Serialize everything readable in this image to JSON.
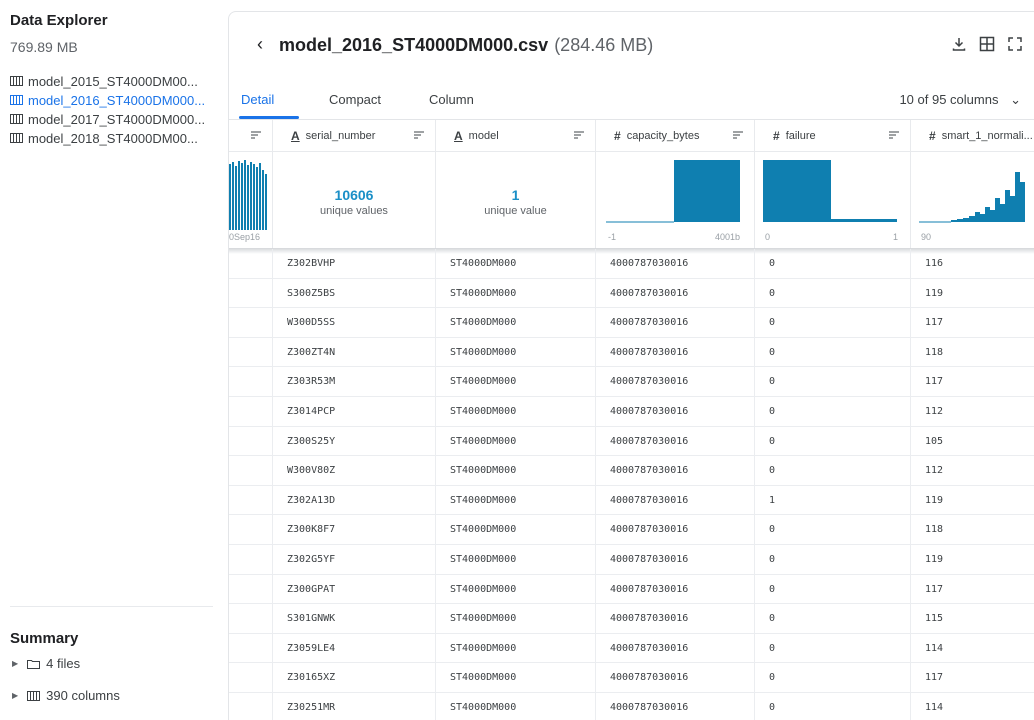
{
  "sidebar": {
    "title": "Data Explorer",
    "size": "769.89 MB",
    "files": [
      {
        "label": "model_2015_ST4000DM00...",
        "active": false
      },
      {
        "label": "model_2016_ST4000DM000...",
        "active": true
      },
      {
        "label": "model_2017_ST4000DM000...",
        "active": false
      },
      {
        "label": "model_2018_ST4000DM00...",
        "active": false
      }
    ],
    "summary_title": "Summary",
    "summary_files": "4 files",
    "summary_columns": "390 columns"
  },
  "header": {
    "back_icon": "chevron-left-icon",
    "file_name": "model_2016_ST4000DM000.csv",
    "file_size": "(284.46 MB)",
    "actions": [
      "download-icon",
      "table-view-icon",
      "fullscreen-icon"
    ]
  },
  "tabs": [
    {
      "label": "Detail",
      "active": true
    },
    {
      "label": "Compact",
      "active": false
    },
    {
      "label": "Column",
      "active": false
    }
  ],
  "columns_count": "10 of 95 columns",
  "grid": {
    "columns": [
      {
        "type": "",
        "name": ""
      },
      {
        "type": "A",
        "name": "serial_number"
      },
      {
        "type": "A",
        "name": "model"
      },
      {
        "type": "#",
        "name": "capacity_bytes"
      },
      {
        "type": "#",
        "name": "failure"
      },
      {
        "type": "#",
        "name": "smart_1_normali..."
      }
    ],
    "stats": {
      "date_axis_label": "0Sep16",
      "serial_unique": "10606",
      "serial_unique_label": "unique values",
      "model_unique": "1",
      "model_unique_label": "unique value",
      "capacity_min": "-1",
      "capacity_max": "4001b",
      "failure_min": "0",
      "failure_max": "1",
      "smart_min": "90"
    },
    "rows": [
      [
        "Z302BVHP",
        "ST4000DM000",
        "4000787030016",
        "0",
        "116"
      ],
      [
        "S300Z5BS",
        "ST4000DM000",
        "4000787030016",
        "0",
        "119"
      ],
      [
        "W300D5SS",
        "ST4000DM000",
        "4000787030016",
        "0",
        "117"
      ],
      [
        "Z300ZT4N",
        "ST4000DM000",
        "4000787030016",
        "0",
        "118"
      ],
      [
        "Z303R53M",
        "ST4000DM000",
        "4000787030016",
        "0",
        "117"
      ],
      [
        "Z3014PCP",
        "ST4000DM000",
        "4000787030016",
        "0",
        "112"
      ],
      [
        "Z300S25Y",
        "ST4000DM000",
        "4000787030016",
        "0",
        "105"
      ],
      [
        "W300V80Z",
        "ST4000DM000",
        "4000787030016",
        "0",
        "112"
      ],
      [
        "Z302A13D",
        "ST4000DM000",
        "4000787030016",
        "1",
        "119"
      ],
      [
        "Z300K8F7",
        "ST4000DM000",
        "4000787030016",
        "0",
        "118"
      ],
      [
        "Z302G5YF",
        "ST4000DM000",
        "4000787030016",
        "0",
        "119"
      ],
      [
        "Z300GPAT",
        "ST4000DM000",
        "4000787030016",
        "0",
        "117"
      ],
      [
        "S301GNWK",
        "ST4000DM000",
        "4000787030016",
        "0",
        "115"
      ],
      [
        "Z3059LE4",
        "ST4000DM000",
        "4000787030016",
        "0",
        "114"
      ],
      [
        "Z30165XZ",
        "ST4000DM000",
        "4000787030016",
        "0",
        "117"
      ],
      [
        "Z30251MR",
        "ST4000DM000",
        "4000787030016",
        "0",
        "114"
      ]
    ]
  },
  "colors": {
    "accent": "#1a73e8",
    "bar": "#0f7fb0",
    "unique_count": "#1a8fc7"
  }
}
